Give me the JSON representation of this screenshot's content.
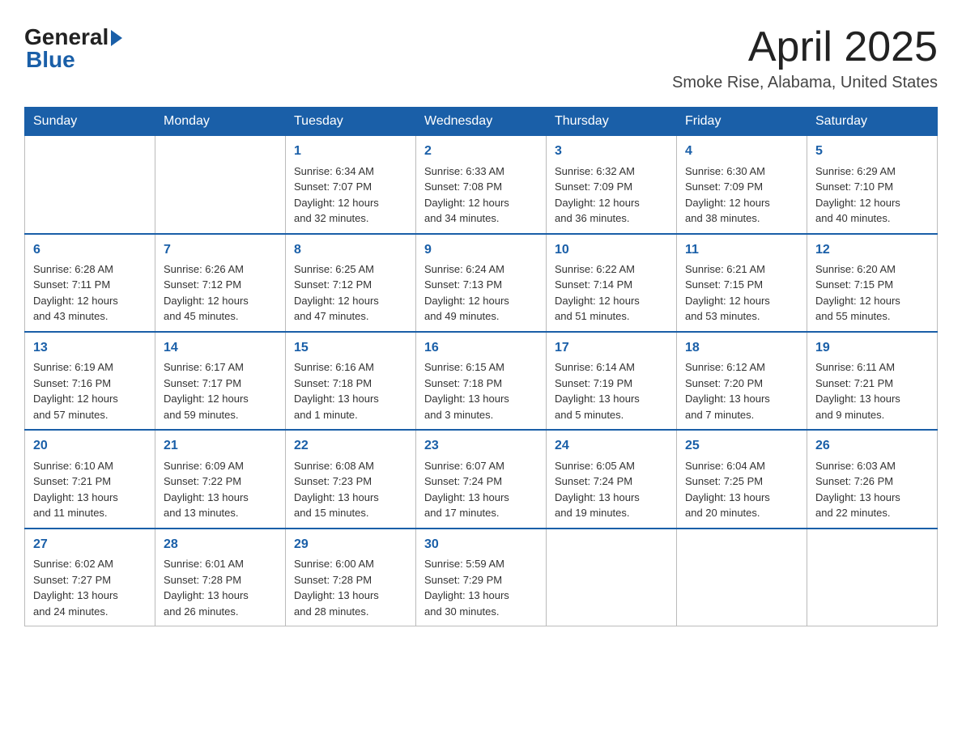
{
  "logo": {
    "general": "General",
    "blue": "Blue"
  },
  "header": {
    "month": "April 2025",
    "location": "Smoke Rise, Alabama, United States"
  },
  "weekdays": [
    "Sunday",
    "Monday",
    "Tuesday",
    "Wednesday",
    "Thursday",
    "Friday",
    "Saturday"
  ],
  "weeks": [
    [
      {
        "day": "",
        "info": ""
      },
      {
        "day": "",
        "info": ""
      },
      {
        "day": "1",
        "info": "Sunrise: 6:34 AM\nSunset: 7:07 PM\nDaylight: 12 hours\nand 32 minutes."
      },
      {
        "day": "2",
        "info": "Sunrise: 6:33 AM\nSunset: 7:08 PM\nDaylight: 12 hours\nand 34 minutes."
      },
      {
        "day": "3",
        "info": "Sunrise: 6:32 AM\nSunset: 7:09 PM\nDaylight: 12 hours\nand 36 minutes."
      },
      {
        "day": "4",
        "info": "Sunrise: 6:30 AM\nSunset: 7:09 PM\nDaylight: 12 hours\nand 38 minutes."
      },
      {
        "day": "5",
        "info": "Sunrise: 6:29 AM\nSunset: 7:10 PM\nDaylight: 12 hours\nand 40 minutes."
      }
    ],
    [
      {
        "day": "6",
        "info": "Sunrise: 6:28 AM\nSunset: 7:11 PM\nDaylight: 12 hours\nand 43 minutes."
      },
      {
        "day": "7",
        "info": "Sunrise: 6:26 AM\nSunset: 7:12 PM\nDaylight: 12 hours\nand 45 minutes."
      },
      {
        "day": "8",
        "info": "Sunrise: 6:25 AM\nSunset: 7:12 PM\nDaylight: 12 hours\nand 47 minutes."
      },
      {
        "day": "9",
        "info": "Sunrise: 6:24 AM\nSunset: 7:13 PM\nDaylight: 12 hours\nand 49 minutes."
      },
      {
        "day": "10",
        "info": "Sunrise: 6:22 AM\nSunset: 7:14 PM\nDaylight: 12 hours\nand 51 minutes."
      },
      {
        "day": "11",
        "info": "Sunrise: 6:21 AM\nSunset: 7:15 PM\nDaylight: 12 hours\nand 53 minutes."
      },
      {
        "day": "12",
        "info": "Sunrise: 6:20 AM\nSunset: 7:15 PM\nDaylight: 12 hours\nand 55 minutes."
      }
    ],
    [
      {
        "day": "13",
        "info": "Sunrise: 6:19 AM\nSunset: 7:16 PM\nDaylight: 12 hours\nand 57 minutes."
      },
      {
        "day": "14",
        "info": "Sunrise: 6:17 AM\nSunset: 7:17 PM\nDaylight: 12 hours\nand 59 minutes."
      },
      {
        "day": "15",
        "info": "Sunrise: 6:16 AM\nSunset: 7:18 PM\nDaylight: 13 hours\nand 1 minute."
      },
      {
        "day": "16",
        "info": "Sunrise: 6:15 AM\nSunset: 7:18 PM\nDaylight: 13 hours\nand 3 minutes."
      },
      {
        "day": "17",
        "info": "Sunrise: 6:14 AM\nSunset: 7:19 PM\nDaylight: 13 hours\nand 5 minutes."
      },
      {
        "day": "18",
        "info": "Sunrise: 6:12 AM\nSunset: 7:20 PM\nDaylight: 13 hours\nand 7 minutes."
      },
      {
        "day": "19",
        "info": "Sunrise: 6:11 AM\nSunset: 7:21 PM\nDaylight: 13 hours\nand 9 minutes."
      }
    ],
    [
      {
        "day": "20",
        "info": "Sunrise: 6:10 AM\nSunset: 7:21 PM\nDaylight: 13 hours\nand 11 minutes."
      },
      {
        "day": "21",
        "info": "Sunrise: 6:09 AM\nSunset: 7:22 PM\nDaylight: 13 hours\nand 13 minutes."
      },
      {
        "day": "22",
        "info": "Sunrise: 6:08 AM\nSunset: 7:23 PM\nDaylight: 13 hours\nand 15 minutes."
      },
      {
        "day": "23",
        "info": "Sunrise: 6:07 AM\nSunset: 7:24 PM\nDaylight: 13 hours\nand 17 minutes."
      },
      {
        "day": "24",
        "info": "Sunrise: 6:05 AM\nSunset: 7:24 PM\nDaylight: 13 hours\nand 19 minutes."
      },
      {
        "day": "25",
        "info": "Sunrise: 6:04 AM\nSunset: 7:25 PM\nDaylight: 13 hours\nand 20 minutes."
      },
      {
        "day": "26",
        "info": "Sunrise: 6:03 AM\nSunset: 7:26 PM\nDaylight: 13 hours\nand 22 minutes."
      }
    ],
    [
      {
        "day": "27",
        "info": "Sunrise: 6:02 AM\nSunset: 7:27 PM\nDaylight: 13 hours\nand 24 minutes."
      },
      {
        "day": "28",
        "info": "Sunrise: 6:01 AM\nSunset: 7:28 PM\nDaylight: 13 hours\nand 26 minutes."
      },
      {
        "day": "29",
        "info": "Sunrise: 6:00 AM\nSunset: 7:28 PM\nDaylight: 13 hours\nand 28 minutes."
      },
      {
        "day": "30",
        "info": "Sunrise: 5:59 AM\nSunset: 7:29 PM\nDaylight: 13 hours\nand 30 minutes."
      },
      {
        "day": "",
        "info": ""
      },
      {
        "day": "",
        "info": ""
      },
      {
        "day": "",
        "info": ""
      }
    ]
  ]
}
